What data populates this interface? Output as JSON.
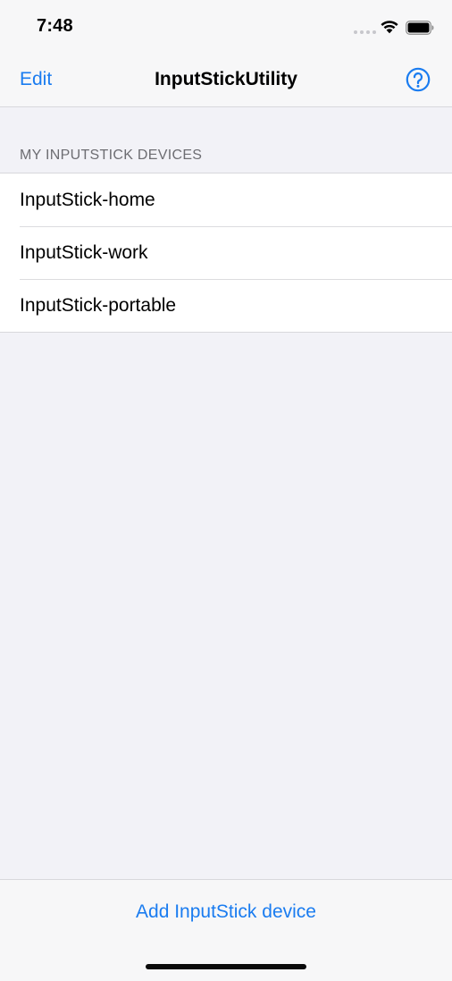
{
  "status_bar": {
    "time": "7:48",
    "icons": [
      "signal-dots-icon",
      "wifi-icon",
      "battery-icon"
    ]
  },
  "nav": {
    "edit_label": "Edit",
    "title": "InputStickUtility",
    "help_icon": "question-circle-icon"
  },
  "section": {
    "header": "MY INPUTSTICK DEVICES",
    "items": [
      {
        "label": "InputStick-home"
      },
      {
        "label": "InputStick-work"
      },
      {
        "label": "InputStick-portable"
      }
    ]
  },
  "toolbar": {
    "add_label": "Add InputStick device"
  },
  "colors": {
    "accent": "#1a7cf0",
    "background": "#f2f2f7",
    "bar_background": "#f7f7f8",
    "secondary_text": "#6d6d72"
  }
}
